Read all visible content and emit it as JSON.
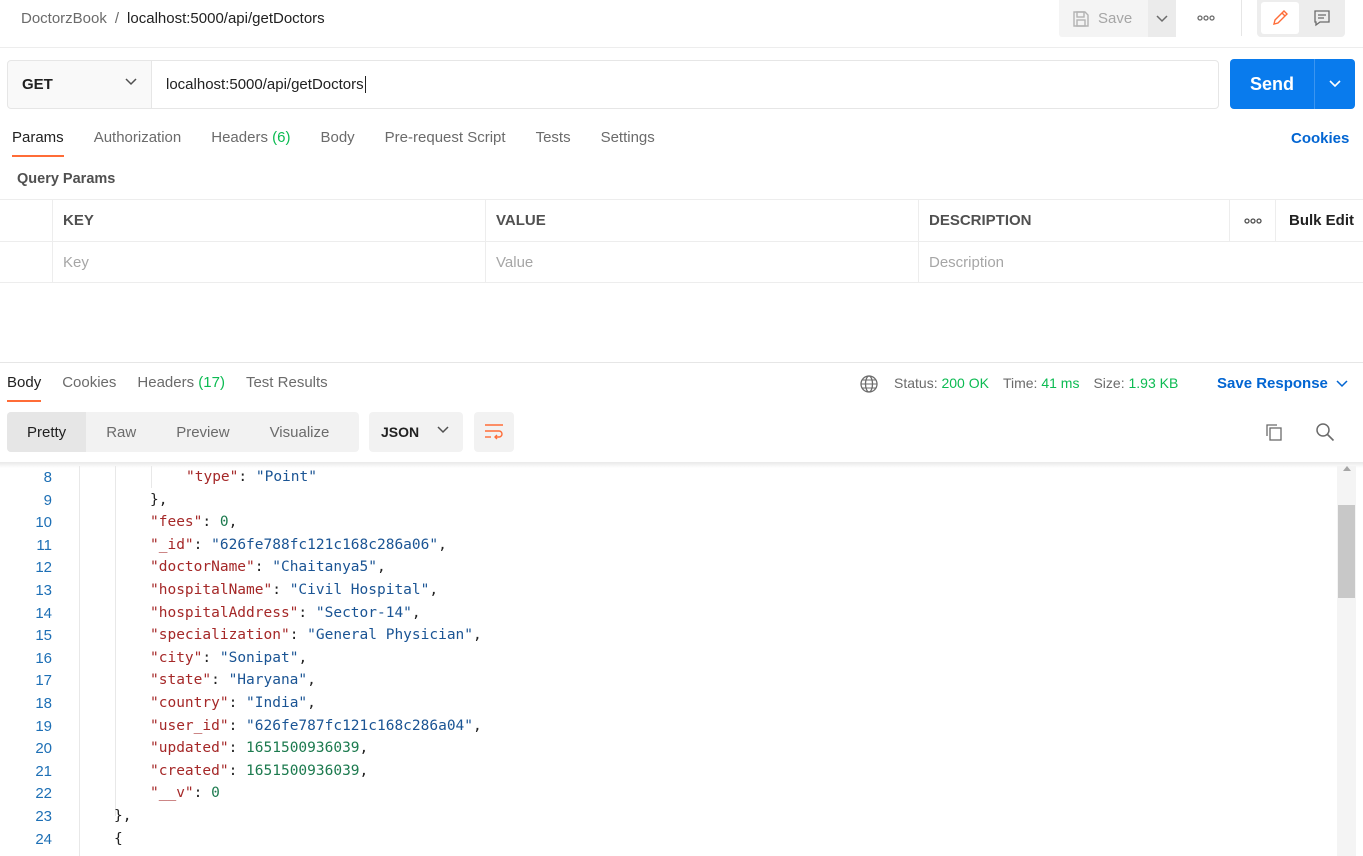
{
  "header": {
    "collection": "DoctorzBook",
    "separator": "/",
    "request_name": "localhost:5000/api/getDoctors",
    "save_label": "Save"
  },
  "request": {
    "method": "GET",
    "url": "localhost:5000/api/getDoctors",
    "send_label": "Send"
  },
  "request_tabs": [
    {
      "label": "Params",
      "count": ""
    },
    {
      "label": "Authorization",
      "count": ""
    },
    {
      "label": "Headers",
      "count": "(6)"
    },
    {
      "label": "Body",
      "count": ""
    },
    {
      "label": "Pre-request Script",
      "count": ""
    },
    {
      "label": "Tests",
      "count": ""
    },
    {
      "label": "Settings",
      "count": ""
    }
  ],
  "cookies_link": "Cookies",
  "query_params": {
    "title": "Query Params",
    "columns": [
      "KEY",
      "VALUE",
      "DESCRIPTION"
    ],
    "bulk_edit": "Bulk Edit",
    "placeholders": {
      "key": "Key",
      "value": "Value",
      "description": "Description"
    }
  },
  "response": {
    "tabs": [
      {
        "label": "Body",
        "count": ""
      },
      {
        "label": "Cookies",
        "count": ""
      },
      {
        "label": "Headers",
        "count": "(17)"
      },
      {
        "label": "Test Results",
        "count": ""
      }
    ],
    "status_label": "Status:",
    "status_value": "200 OK",
    "time_label": "Time:",
    "time_value": "41 ms",
    "size_label": "Size:",
    "size_value": "1.93 KB",
    "save_response": "Save Response",
    "formats": [
      "Pretty",
      "Raw",
      "Preview",
      "Visualize"
    ],
    "language": "JSON"
  },
  "code_lines": [
    {
      "n": "8",
      "indent": 2,
      "parts": [
        [
          "k",
          "\"type\""
        ],
        [
          "p",
          ": "
        ],
        [
          "s",
          "\"Point\""
        ]
      ]
    },
    {
      "n": "9",
      "indent": 1,
      "parts": [
        [
          "p",
          "},"
        ]
      ]
    },
    {
      "n": "10",
      "indent": 1,
      "parts": [
        [
          "k",
          "\"fees\""
        ],
        [
          "p",
          ": "
        ],
        [
          "n",
          "0"
        ],
        [
          "p",
          ","
        ]
      ]
    },
    {
      "n": "11",
      "indent": 1,
      "parts": [
        [
          "k",
          "\"_id\""
        ],
        [
          "p",
          ": "
        ],
        [
          "s",
          "\"626fe788fc121c168c286a06\""
        ],
        [
          "p",
          ","
        ]
      ]
    },
    {
      "n": "12",
      "indent": 1,
      "parts": [
        [
          "k",
          "\"doctorName\""
        ],
        [
          "p",
          ": "
        ],
        [
          "s",
          "\"Chaitanya5\""
        ],
        [
          "p",
          ","
        ]
      ]
    },
    {
      "n": "13",
      "indent": 1,
      "parts": [
        [
          "k",
          "\"hospitalName\""
        ],
        [
          "p",
          ": "
        ],
        [
          "s",
          "\"Civil Hospital\""
        ],
        [
          "p",
          ","
        ]
      ]
    },
    {
      "n": "14",
      "indent": 1,
      "parts": [
        [
          "k",
          "\"hospitalAddress\""
        ],
        [
          "p",
          ": "
        ],
        [
          "s",
          "\"Sector-14\""
        ],
        [
          "p",
          ","
        ]
      ]
    },
    {
      "n": "15",
      "indent": 1,
      "parts": [
        [
          "k",
          "\"specialization\""
        ],
        [
          "p",
          ": "
        ],
        [
          "s",
          "\"General Physician\""
        ],
        [
          "p",
          ","
        ]
      ]
    },
    {
      "n": "16",
      "indent": 1,
      "parts": [
        [
          "k",
          "\"city\""
        ],
        [
          "p",
          ": "
        ],
        [
          "s",
          "\"Sonipat\""
        ],
        [
          "p",
          ","
        ]
      ]
    },
    {
      "n": "17",
      "indent": 1,
      "parts": [
        [
          "k",
          "\"state\""
        ],
        [
          "p",
          ": "
        ],
        [
          "s",
          "\"Haryana\""
        ],
        [
          "p",
          ","
        ]
      ]
    },
    {
      "n": "18",
      "indent": 1,
      "parts": [
        [
          "k",
          "\"country\""
        ],
        [
          "p",
          ": "
        ],
        [
          "s",
          "\"India\""
        ],
        [
          "p",
          ","
        ]
      ]
    },
    {
      "n": "19",
      "indent": 1,
      "parts": [
        [
          "k",
          "\"user_id\""
        ],
        [
          "p",
          ": "
        ],
        [
          "s",
          "\"626fe787fc121c168c286a04\""
        ],
        [
          "p",
          ","
        ]
      ]
    },
    {
      "n": "20",
      "indent": 1,
      "parts": [
        [
          "k",
          "\"updated\""
        ],
        [
          "p",
          ": "
        ],
        [
          "n",
          "1651500936039"
        ],
        [
          "p",
          ","
        ]
      ]
    },
    {
      "n": "21",
      "indent": 1,
      "parts": [
        [
          "k",
          "\"created\""
        ],
        [
          "p",
          ": "
        ],
        [
          "n",
          "1651500936039"
        ],
        [
          "p",
          ","
        ]
      ]
    },
    {
      "n": "22",
      "indent": 1,
      "parts": [
        [
          "k",
          "\"__v\""
        ],
        [
          "p",
          ": "
        ],
        [
          "n",
          "0"
        ]
      ]
    },
    {
      "n": "23",
      "indent": 0,
      "parts": [
        [
          "p",
          "},"
        ]
      ]
    },
    {
      "n": "24",
      "indent": 0,
      "parts": [
        [
          "p",
          "{"
        ]
      ]
    }
  ],
  "colors": {
    "accent": "#ff6c37",
    "send_blue": "#097bed",
    "link_blue": "#0265d2",
    "status_green": "#0cbb52",
    "json_key": "#a52828",
    "json_string": "#1a5494",
    "json_number": "#1c7a4e"
  }
}
